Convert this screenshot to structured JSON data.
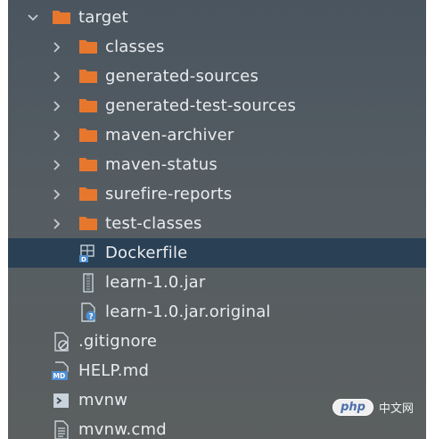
{
  "tree": {
    "items": [
      {
        "label": "target",
        "icon": "folder-icon",
        "expanded": true
      },
      {
        "label": "classes",
        "icon": "folder-icon",
        "expanded": false
      },
      {
        "label": "generated-sources",
        "icon": "folder-icon",
        "expanded": false
      },
      {
        "label": "generated-test-sources",
        "icon": "folder-icon",
        "expanded": false
      },
      {
        "label": "maven-archiver",
        "icon": "folder-icon",
        "expanded": false
      },
      {
        "label": "maven-status",
        "icon": "folder-icon",
        "expanded": false
      },
      {
        "label": "surefire-reports",
        "icon": "folder-icon",
        "expanded": false
      },
      {
        "label": "test-classes",
        "icon": "folder-icon",
        "expanded": false
      },
      {
        "label": "Dockerfile",
        "icon": "dockerfile-icon",
        "selected": true
      },
      {
        "label": "learn-1.0.jar",
        "icon": "jar-icon"
      },
      {
        "label": "learn-1.0.jar.original",
        "icon": "unknown-file-icon"
      },
      {
        "label": ".gitignore",
        "icon": "gitignore-icon"
      },
      {
        "label": "HELP.md",
        "icon": "markdown-icon"
      },
      {
        "label": "mvnw",
        "icon": "shell-script-icon"
      },
      {
        "label": "mvnw.cmd",
        "icon": "text-file-icon"
      }
    ]
  },
  "watermark": {
    "logo": "php",
    "text": "中文网"
  },
  "colors": {
    "folder": "#e8772e",
    "selection": "#2a4055",
    "text": "#e9ecef"
  }
}
